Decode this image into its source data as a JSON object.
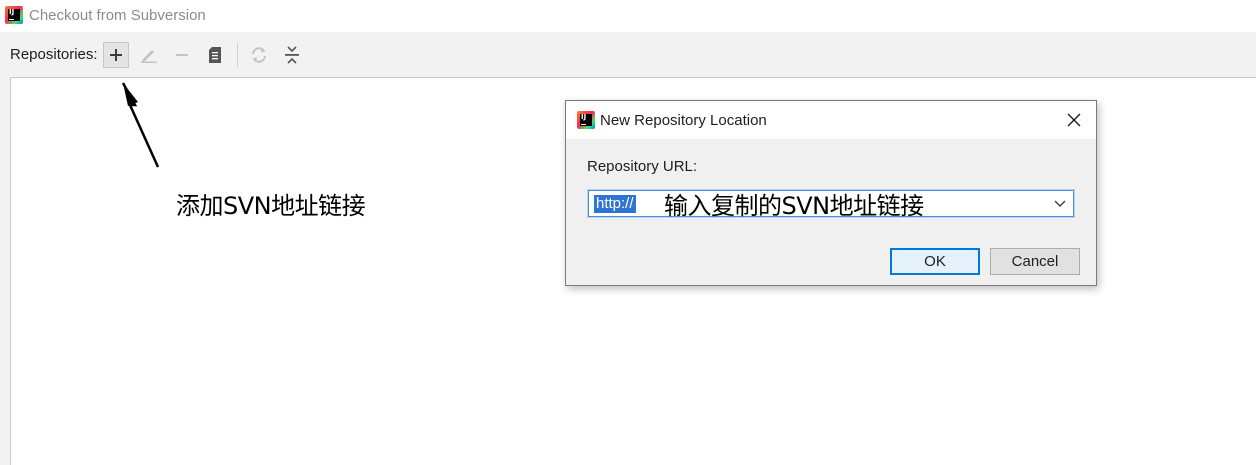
{
  "window": {
    "title": "Checkout from Subversion"
  },
  "toolbar": {
    "repositories_label": "Repositories:",
    "icons": [
      "plus-icon",
      "edit-icon",
      "minus-icon",
      "clipboard-icon",
      "refresh-icon",
      "collapse-icon"
    ]
  },
  "annotations": {
    "add_hint": "添加SVN地址链接",
    "url_hint": "输入复制的SVN地址链接"
  },
  "dialog": {
    "title": "New Repository Location",
    "url_label": "Repository URL:",
    "url_value": "http://",
    "ok_label": "OK",
    "cancel_label": "Cancel"
  }
}
